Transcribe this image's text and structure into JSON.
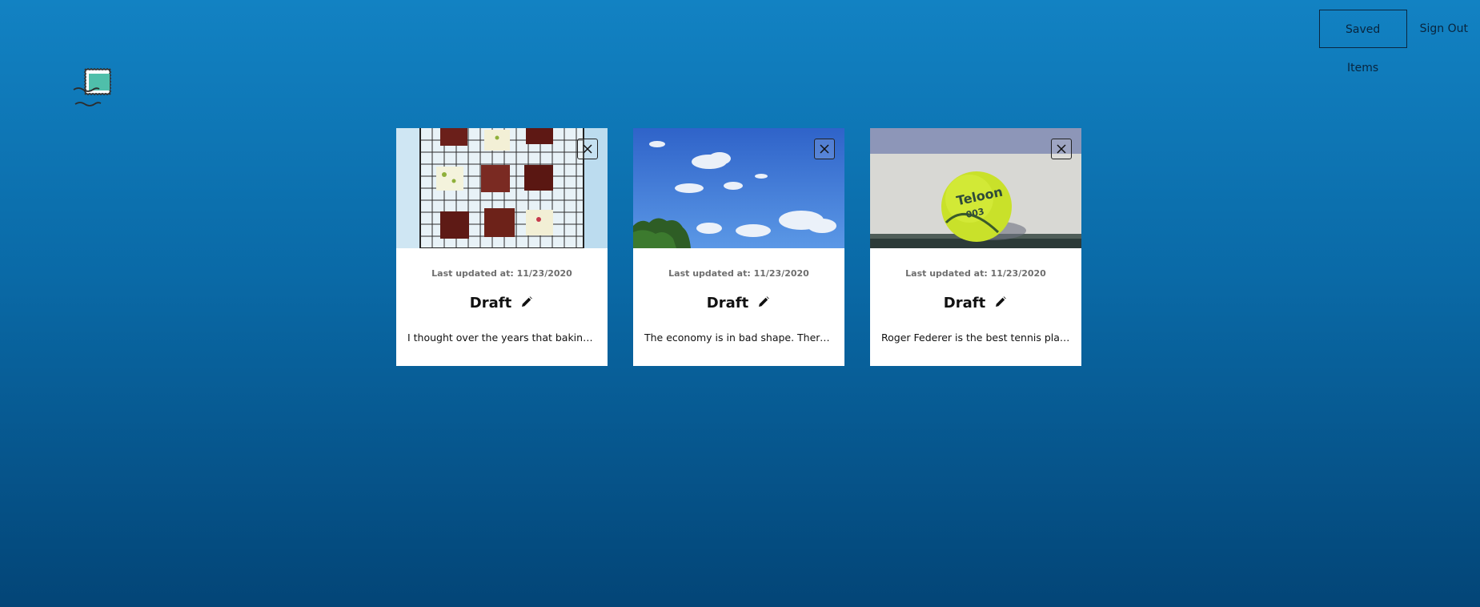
{
  "nav": {
    "saved_items_label": "Saved Items",
    "sign_out_label": "Sign Out"
  },
  "logo": {
    "icon": "postage-stamp-icon"
  },
  "cards": [
    {
      "image": "brownies-on-cooling-rack",
      "updated_prefix": "Last updated at: ",
      "updated_date": "11/23/2020",
      "title": "Draft",
      "excerpt": "I thought over the years that baking …",
      "delete_icon": "close-icon",
      "edit_icon": "pencil-icon"
    },
    {
      "image": "blue-sky-with-clouds",
      "updated_prefix": "Last updated at: ",
      "updated_date": "11/23/2020",
      "title": "Draft",
      "excerpt": "The economy is in bad shape. There a…",
      "delete_icon": "close-icon",
      "edit_icon": "pencil-icon"
    },
    {
      "image": "tennis-ball-on-court",
      "updated_prefix": "Last updated at: ",
      "updated_date": "11/23/2020",
      "title": "Draft",
      "excerpt": "Roger Federer is the best tennis play…",
      "delete_icon": "close-icon",
      "edit_icon": "pencil-icon"
    }
  ],
  "colors": {
    "background_top": "#1282c3",
    "background_bottom": "#034577",
    "card": "#ffffff",
    "stamp": "#4fbfaa"
  }
}
